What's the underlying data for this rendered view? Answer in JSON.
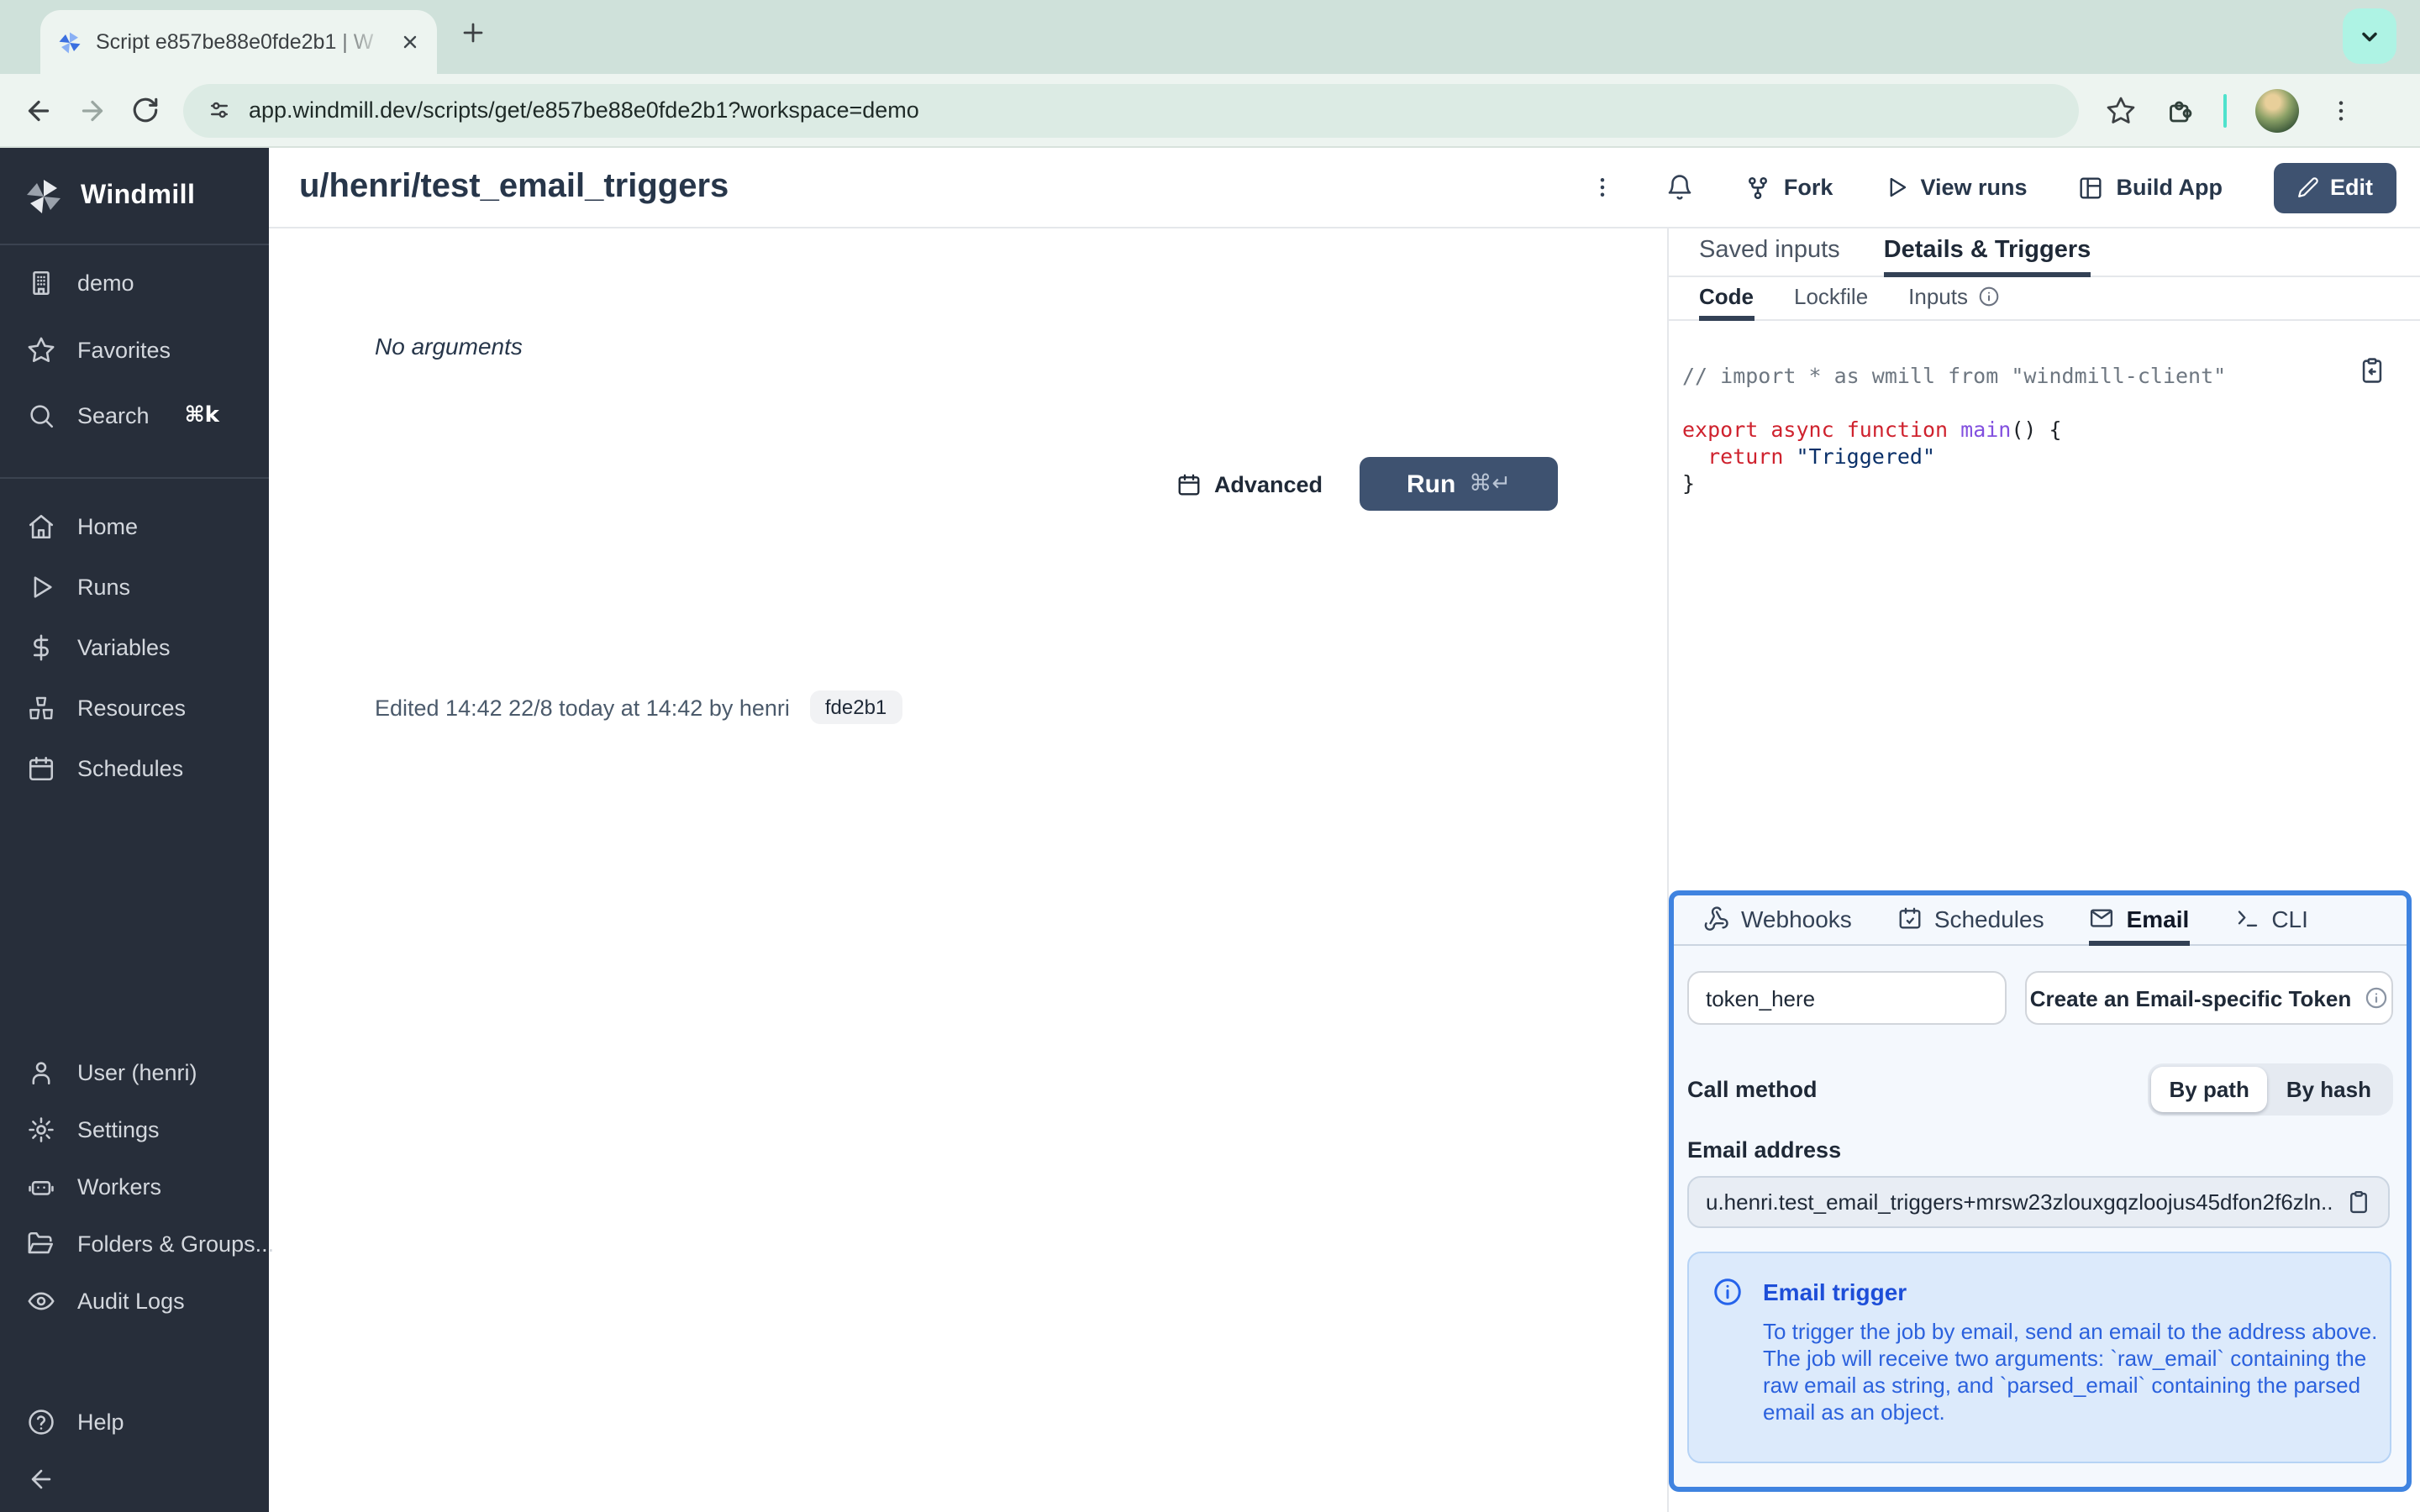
{
  "browser": {
    "tab_title": "Script e857be88e0fde2b1 | W",
    "url": "app.windmill.dev/scripts/get/e857be88e0fde2b1?workspace=demo"
  },
  "sidebar": {
    "brand": "Windmill",
    "workspace": "demo",
    "favorites": "Favorites",
    "search": "Search",
    "search_kbd": "⌘k",
    "home": "Home",
    "runs": "Runs",
    "variables": "Variables",
    "resources": "Resources",
    "schedules": "Schedules",
    "user": "User (henri)",
    "settings": "Settings",
    "workers": "Workers",
    "folders": "Folders & Groups...",
    "audit": "Audit Logs",
    "help": "Help"
  },
  "header": {
    "title": "u/henri/test_email_triggers",
    "fork": "Fork",
    "view_runs": "View runs",
    "build_app": "Build App",
    "edit": "Edit"
  },
  "run_panel": {
    "no_arguments": "No arguments",
    "advanced": "Advanced",
    "run": "Run",
    "run_kbd": "⌘↵",
    "edited": "Edited 14:42 22/8 today at 14:42 by henri",
    "hash_badge": "fde2b1"
  },
  "details": {
    "tab_saved_inputs": "Saved inputs",
    "tab_details_triggers": "Details & Triggers",
    "tab_code": "Code",
    "tab_lockfile": "Lockfile",
    "tab_inputs": "Inputs",
    "code": {
      "comment": "// import * as wmill from \"windmill-client\"",
      "kw_export": "export ",
      "kw_async": "async ",
      "kw_function": "function ",
      "fn_main": "main",
      "punct_call": "() {",
      "kw_return": "  return ",
      "str_triggered": "\"Triggered\"",
      "brace_close": "}"
    }
  },
  "triggers": {
    "tab_webhooks": "Webhooks",
    "tab_schedules": "Schedules",
    "tab_email": "Email",
    "tab_cli": "CLI",
    "token_value": "token_here",
    "create_token": "Create an Email-specific Token",
    "call_method_label": "Call method",
    "by_path": "By path",
    "by_hash": "By hash",
    "email_address_label": "Email address",
    "email_value": "u.henri.test_email_triggers+mrsw23zlouxgqzloojus45dfon2f6zln...",
    "info_title": "Email trigger",
    "info_body": "To trigger the job by email, send an email to the address above. The job will receive two arguments: `raw_email` containing the raw email as string, and `parsed_email` containing the parsed email as an object."
  },
  "colors": {
    "primary_navy": "#3e5270",
    "panel_border_blue": "#3f83e0",
    "info_blue": "#2563eb"
  }
}
